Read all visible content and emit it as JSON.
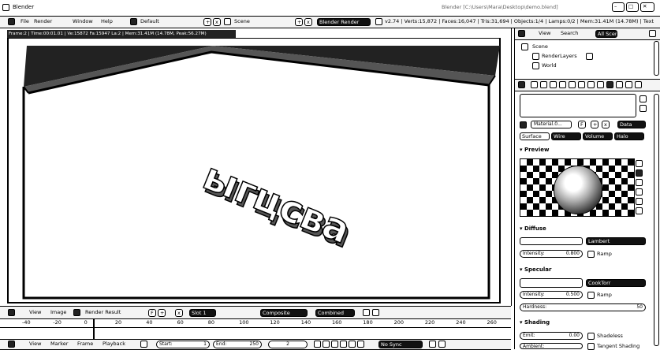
{
  "window": {
    "title": "Blender",
    "right_title": "Blender  [C:\\Users\\Mara\\Desktop\\demo.blend]"
  },
  "info_header": {
    "menus": [
      "File",
      "Render",
      "Window",
      "Help"
    ],
    "layout": "Default",
    "scene": "Scene",
    "engine": "Blender Render",
    "stats": "v2.74 | Verts:15,872 | Faces:16,047 | Tris:31,694 | Objects:1/4 | Lamps:0/2 | Mem:31.41M (14.78M) | Text"
  },
  "viewport": {
    "render_info": "Frame:2 | Time:00:01.01 | Ve:15872 Fa:15947 La:2 | Mem:31.41M (14.78M, Peak:56.27M)",
    "render_text": "ыгцсва"
  },
  "image_header": {
    "view": "View",
    "image": "Image",
    "render_result": "Render Result",
    "slot": "Slot 1",
    "composite": "Composite",
    "combined": "Combined"
  },
  "timeline": {
    "ticks": [
      "-40",
      "-20",
      "0",
      "20",
      "40",
      "60",
      "80",
      "100",
      "120",
      "140",
      "160",
      "180",
      "200",
      "220",
      "240",
      "260"
    ],
    "view": "View",
    "marker": "Marker",
    "frame": "Frame",
    "playback": "Playback",
    "start_label": "Start:",
    "start": "1",
    "end_label": "End:",
    "end": "250",
    "current": "2",
    "sync": "No Sync"
  },
  "outliner": {
    "view": "View",
    "search": "Search",
    "all_scenes": "All Scenes",
    "items": [
      "Scene",
      "RenderLayers",
      "World"
    ]
  },
  "properties": {
    "material_name": "Material.0...",
    "data_btn": "Data",
    "tabs": [
      "Surface",
      "Wire",
      "Volume",
      "Halo"
    ],
    "preview_label": "Preview",
    "diffuse": {
      "label": "Diffuse",
      "shader": "Lambert",
      "intensity_label": "Intensity:",
      "intensity": "0.800",
      "ramp": "Ramp"
    },
    "specular": {
      "label": "Specular",
      "shader": "CookTorr",
      "intensity_label": "Intensity:",
      "intensity": "0.500",
      "ramp": "Ramp",
      "hardness_label": "Hardness:",
      "hardness": "50"
    },
    "shading": {
      "label": "Shading",
      "emit_label": "Emit:",
      "emit": "0.00",
      "shadeless": "Shadeless",
      "ambient_label": "Ambient:",
      "tangent": "Tangent Shading"
    }
  }
}
